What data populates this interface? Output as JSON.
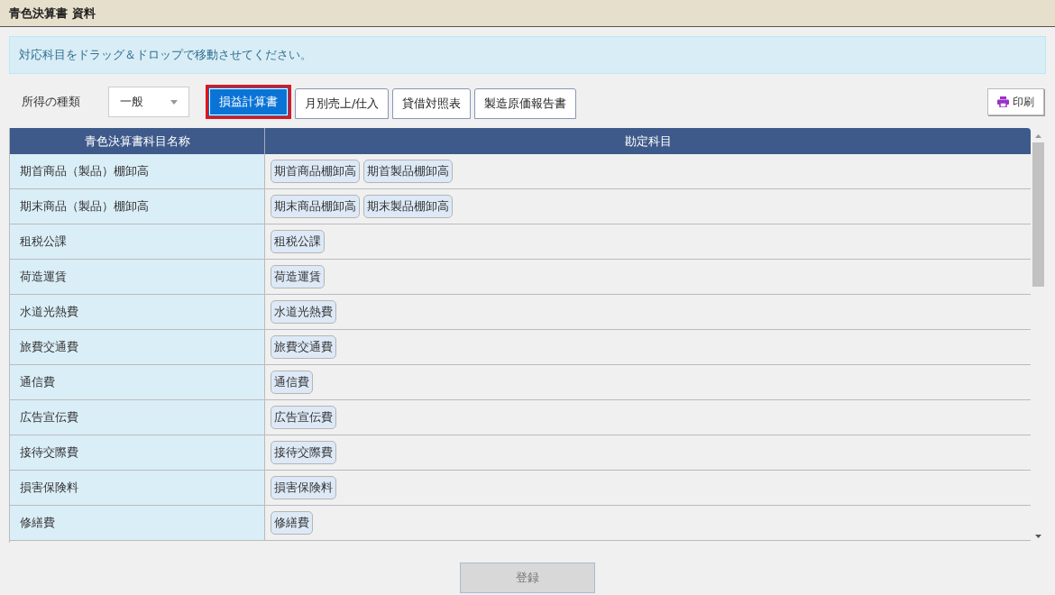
{
  "window": {
    "title": "青色決算書 資料"
  },
  "notice": "対応科目をドラッグ＆ドロップで移動させてください。",
  "income_type": {
    "label": "所得の種類",
    "value": "一般"
  },
  "tabs": [
    {
      "label": "損益計算書",
      "selected": true
    },
    {
      "label": "月別売上/仕入",
      "selected": false
    },
    {
      "label": "貸借対照表",
      "selected": false
    },
    {
      "label": "製造原価報告書",
      "selected": false
    }
  ],
  "print_button": "印刷",
  "table": {
    "columns": [
      "青色決算書科目名称",
      "勘定科目"
    ],
    "rows": [
      {
        "name": "期首商品（製品）棚卸高",
        "accounts": [
          "期首商品棚卸高",
          "期首製品棚卸高"
        ]
      },
      {
        "name": "期末商品（製品）棚卸高",
        "accounts": [
          "期末商品棚卸高",
          "期末製品棚卸高"
        ]
      },
      {
        "name": "租税公課",
        "accounts": [
          "租税公課"
        ]
      },
      {
        "name": "荷造運賃",
        "accounts": [
          "荷造運賃"
        ]
      },
      {
        "name": "水道光熱費",
        "accounts": [
          "水道光熱費"
        ]
      },
      {
        "name": "旅費交通費",
        "accounts": [
          "旅費交通費"
        ]
      },
      {
        "name": "通信費",
        "accounts": [
          "通信費"
        ]
      },
      {
        "name": "広告宣伝費",
        "accounts": [
          "広告宣伝費"
        ]
      },
      {
        "name": "接待交際費",
        "accounts": [
          "接待交際費"
        ]
      },
      {
        "name": "損害保険料",
        "accounts": [
          "損害保険料"
        ]
      },
      {
        "name": "修繕費",
        "accounts": [
          "修繕費"
        ]
      }
    ]
  },
  "register_button": {
    "label": "登録",
    "disabled": true
  }
}
